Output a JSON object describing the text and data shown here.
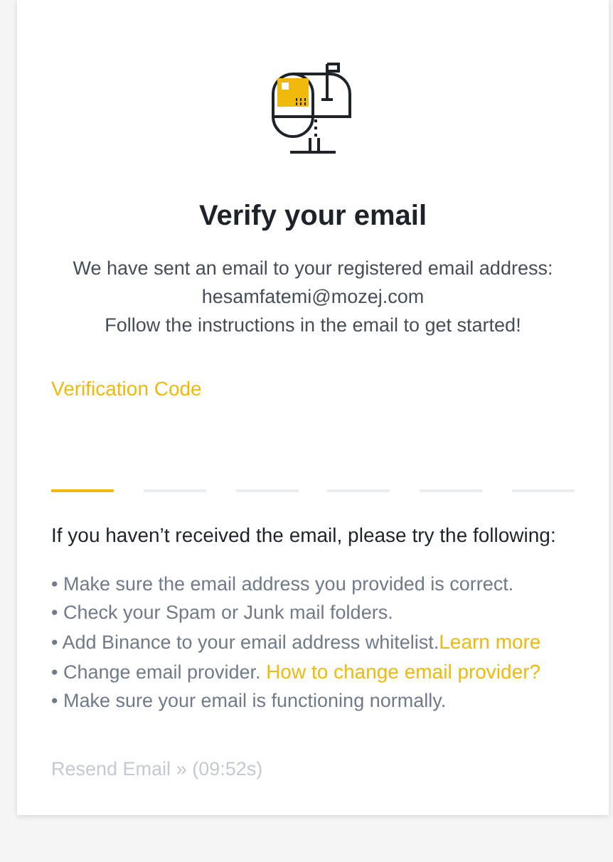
{
  "title": "Verify your email",
  "message": [
    "We have sent an email to your registered email address:",
    "hesamfatemi@mozej.com",
    "Follow the instructions in the email to get started!"
  ],
  "code_field": {
    "label": "Verification Code",
    "slots": [
      {
        "selected": true
      },
      {
        "selected": false
      },
      {
        "selected": false
      },
      {
        "selected": false
      },
      {
        "selected": false
      },
      {
        "selected": false
      }
    ]
  },
  "help_heading": "If you haven’t received the email, please try the following:",
  "tips": [
    {
      "text": "• Make sure the email address you provided is correct."
    },
    {
      "text": "• Check your Spam or Junk mail folders."
    },
    {
      "text": "• Add Binance to your email address whitelist.",
      "link": "Learn more"
    },
    {
      "text": "• Change email provider. ",
      "link": "How to change email provider?"
    },
    {
      "text": "• Make sure your email is functioning normally."
    }
  ],
  "resend": {
    "label": "Resend Email",
    "arrow": "»",
    "timer": "(09:52s)",
    "disabled": true
  }
}
